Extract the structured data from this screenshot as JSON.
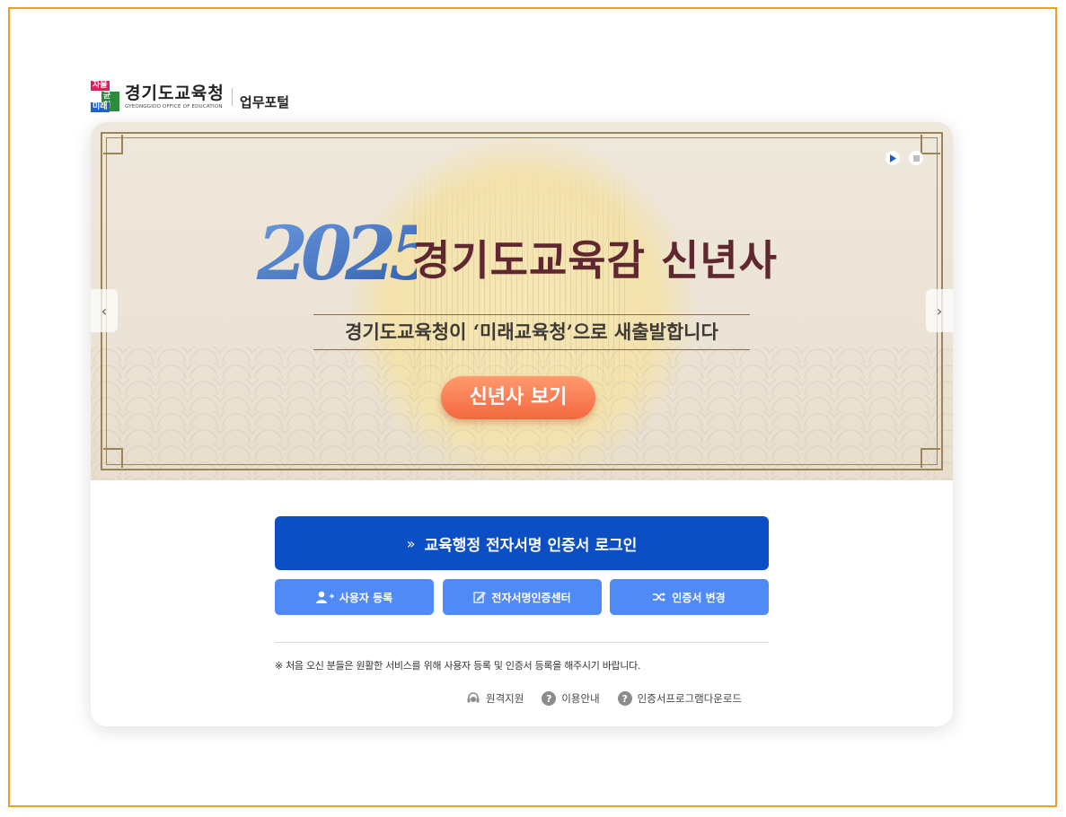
{
  "header": {
    "logo_badge": [
      "자율",
      "균형",
      "미래"
    ],
    "logo_title": "경기도교육청",
    "logo_subtitle": "GYEONGGIDO OFFICE OF EDUCATION",
    "portal_label": "업무포털"
  },
  "banner": {
    "year": "2025",
    "title": "경기도교육감 신년사",
    "subtitle": "경기도교육청이 ‘미래교육청’으로 새출발합니다",
    "button_label": "신년사 보기",
    "controls": {
      "play": "play-icon",
      "stop": "stop-icon"
    },
    "prev_arrow": "‹",
    "next_arrow": "›",
    "colors": {
      "title": "#5f2730",
      "button": "#f4673f",
      "frame": "#9b8456"
    }
  },
  "login": {
    "main_button": {
      "chevron": "»",
      "label": "교육행정 전자서명 인증서 로그인"
    },
    "sub_buttons": [
      {
        "icon": "user-add-icon",
        "label": "사용자 등록"
      },
      {
        "icon": "edit-icon",
        "label": "전자서명인증센터"
      },
      {
        "icon": "shuffle-icon",
        "label": "인증서 변경"
      }
    ],
    "notice": "※ 처음 오신 분들은 원활한 서비스를 위해 사용자 등록 및 인증서 등록을 해주시기 바랍니다.",
    "links": [
      {
        "icon": "headset-icon",
        "label": "원격지원"
      },
      {
        "icon": "question-icon",
        "label": "이용안내"
      },
      {
        "icon": "question-icon",
        "label": "인증서프로그램다운로드"
      }
    ],
    "colors": {
      "primary": "#0c4fc4",
      "secondary": "#4f8af5"
    }
  },
  "page": {
    "border_color": "#eba21f"
  }
}
